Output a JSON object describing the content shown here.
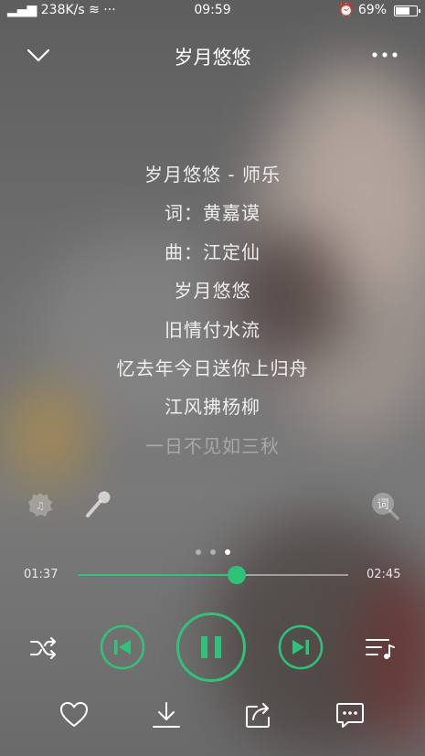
{
  "status_bar": {
    "signal": "▂▄▆ 238K/s ≋ ···",
    "time": "09:59",
    "alarm_battery": "⏰ 69%",
    "battery_level": 0.69
  },
  "header": {
    "title": "岁月悠悠"
  },
  "lyrics": [
    {
      "text": "岁月悠悠 - 师乐"
    },
    {
      "text": "词：黄嘉谟"
    },
    {
      "text": "曲：江定仙"
    },
    {
      "text": "岁月悠悠"
    },
    {
      "text": "旧情付水流"
    },
    {
      "text": "忆去年今日送你上归舟"
    },
    {
      "text": "江风拂杨柳"
    },
    {
      "text": "一日不见如三秋"
    }
  ],
  "tools": {
    "lyric_search_glyph": "词"
  },
  "pager": {
    "count": 3,
    "active": 2
  },
  "progress": {
    "elapsed": "01:37",
    "total": "02:45",
    "fraction": 0.588
  },
  "icons": [
    "chevron-down-icon",
    "more-icon",
    "effect-icon",
    "microphone-icon",
    "lyric-search-icon",
    "shuffle-icon",
    "previous-icon",
    "pause-icon",
    "next-icon",
    "playlist-icon",
    "heart-icon",
    "download-icon",
    "share-icon",
    "comment-icon"
  ],
  "colors": {
    "accent": "#2fc37a",
    "text": "#ffffff"
  }
}
